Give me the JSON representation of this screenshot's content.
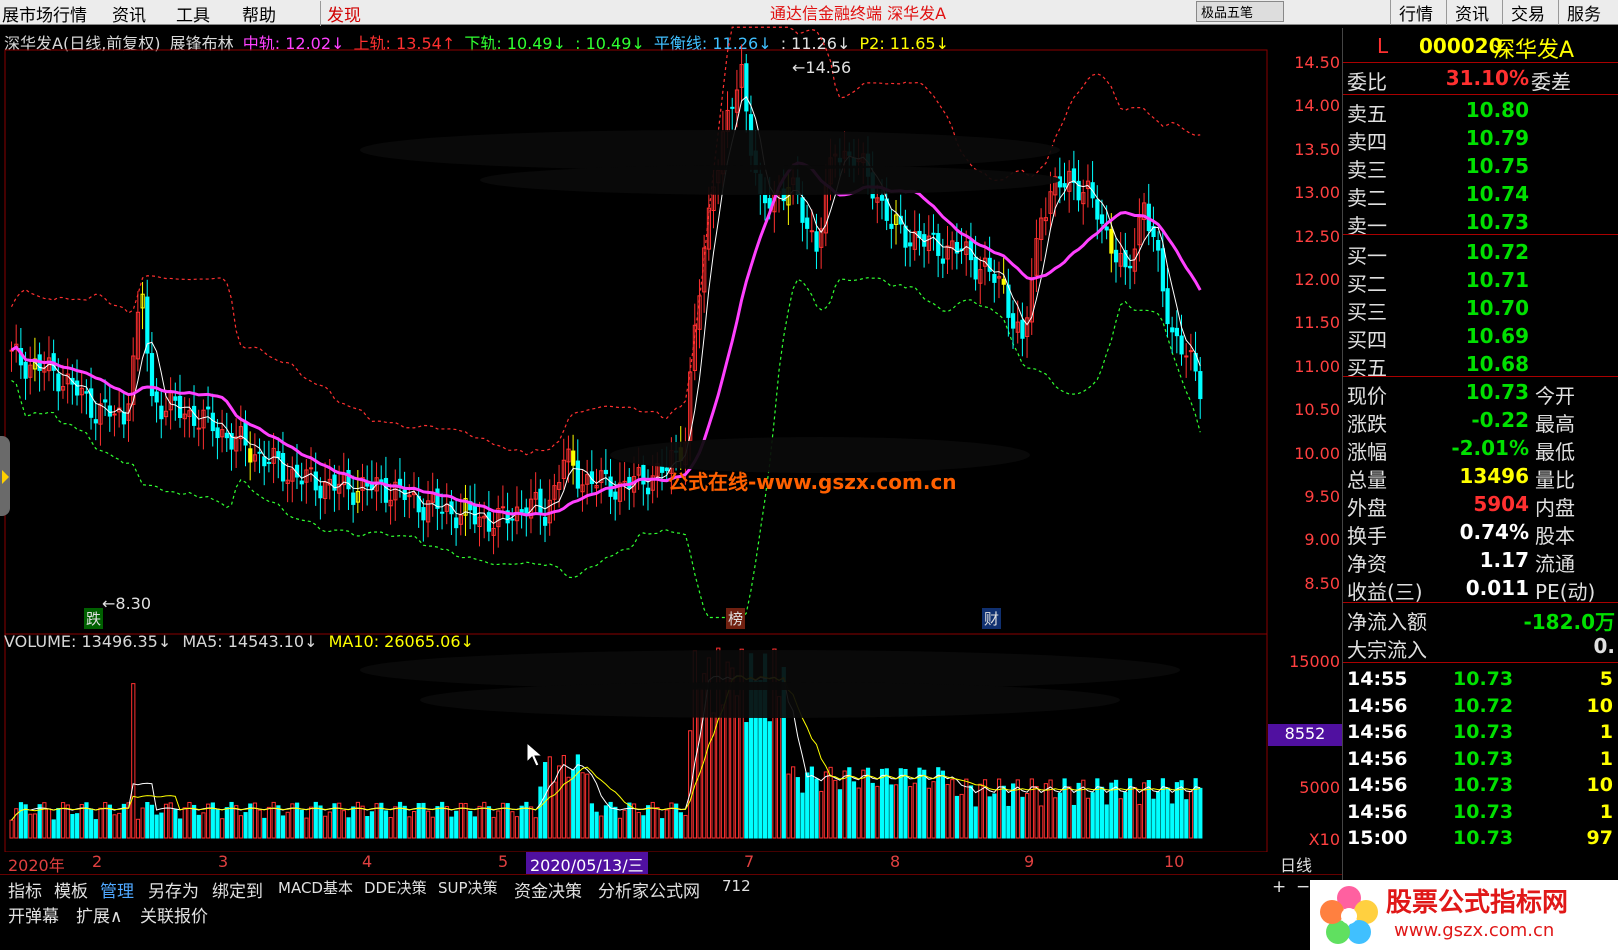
{
  "menu": {
    "items": [
      "展市场行情",
      "资讯",
      "工具",
      "帮助"
    ],
    "faxian": "发现",
    "center_text": "通达信金融终端  深华发A",
    "right_widget": "极品五笔",
    "right_buttons": [
      "行情",
      "资讯",
      "交易",
      "服务"
    ]
  },
  "chart_title": {
    "name": "深华发A(日线,前复权)",
    "indicator": "展锋布林",
    "mid": "中轨: 12.02↓",
    "upper": "上轨: 13.54↑",
    "lower": "下轨: 10.49↓",
    "blank": ": 10.49↓",
    "balance": "平衡线: 11.26↓",
    "blank2": ": 11.26↓",
    "p2": "P2: 11.65↓",
    "colors": {
      "mid": "#ff40ff",
      "upper": "#ff3030",
      "lower": "#30ff30",
      "blank": "#30ff30",
      "balance": "#40c0ff",
      "blank2": "#e0e0e0",
      "p2": "#ffff00"
    }
  },
  "volume_title": {
    "volume": "VOLUME: 13496.35↓",
    "ma5": "MA5: 14543.10↓",
    "ma10": "MA10: 26065.06↓"
  },
  "price_axis": [
    "14.50",
    "14.00",
    "13.50",
    "13.00",
    "12.50",
    "12.00",
    "11.50",
    "11.00",
    "10.50",
    "10.00",
    "9.50",
    "9.00",
    "8.50"
  ],
  "volume_axis": [
    "15000",
    "5000",
    "X10"
  ],
  "volume_highlight": "8552",
  "annotations": {
    "high": "14.56",
    "low": "8.30",
    "die": "跌",
    "bang": "榜",
    "cai": "财"
  },
  "date_axis": [
    "2020年",
    "2",
    "3",
    "4",
    "5",
    "2020/05/13/三",
    "7",
    "8",
    "9",
    "10"
  ],
  "period": "日线",
  "watermark": "公式在线-www.gszx.com.cn",
  "quote": {
    "flag": "L",
    "code": "000020",
    "name": "深华发A",
    "weibi_label": "委比",
    "weibi": "31.10%",
    "weicha_label": "委差",
    "asks": [
      {
        "label": "卖五",
        "price": "10.80"
      },
      {
        "label": "卖四",
        "price": "10.79"
      },
      {
        "label": "卖三",
        "price": "10.75"
      },
      {
        "label": "卖二",
        "price": "10.74"
      },
      {
        "label": "卖一",
        "price": "10.73"
      }
    ],
    "bids": [
      {
        "label": "买一",
        "price": "10.72"
      },
      {
        "label": "买二",
        "price": "10.71"
      },
      {
        "label": "买三",
        "price": "10.70"
      },
      {
        "label": "买四",
        "price": "10.69"
      },
      {
        "label": "买五",
        "price": "10.68"
      }
    ],
    "stats": [
      {
        "label": "现价",
        "value": "10.73",
        "label2": "今开",
        "color": "#00e000"
      },
      {
        "label": "涨跌",
        "value": "-0.22",
        "label2": "最高",
        "color": "#00e000"
      },
      {
        "label": "涨幅",
        "value": "-2.01%",
        "label2": "最低",
        "color": "#00e000"
      },
      {
        "label": "总量",
        "value": "13496",
        "label2": "量比",
        "color": "#ffff00"
      },
      {
        "label": "外盘",
        "value": "5904",
        "label2": "内盘",
        "color": "#ff3030"
      },
      {
        "label": "换手",
        "value": "0.74%",
        "label2": "股本",
        "color": "#ffffff"
      },
      {
        "label": "净资",
        "value": "1.17",
        "label2": "流通",
        "color": "#ffffff"
      },
      {
        "label": "收益(三)",
        "value": "0.011",
        "label2": "PE(动)",
        "color": "#ffffff"
      }
    ],
    "flow": [
      {
        "label": "净流入额",
        "value": "-182.0万"
      },
      {
        "label": "大宗流入",
        "value": "0."
      }
    ],
    "ticks": [
      {
        "time": "14:55",
        "price": "10.73",
        "vol": "5"
      },
      {
        "time": "14:56",
        "price": "10.72",
        "vol": "10"
      },
      {
        "time": "14:56",
        "price": "10.73",
        "vol": "1"
      },
      {
        "time": "14:56",
        "price": "10.73",
        "vol": "1"
      },
      {
        "time": "14:56",
        "price": "10.73",
        "vol": "10"
      },
      {
        "time": "14:56",
        "price": "10.73",
        "vol": "1"
      },
      {
        "time": "15:00",
        "price": "10.73",
        "vol": "97"
      }
    ]
  },
  "tabs": [
    "指标",
    "模板",
    "管理",
    "另存为",
    "绑定到",
    "MACD基本",
    "DDE决策",
    "SUP决策",
    "资金决策",
    "分析家公式网",
    "712"
  ],
  "tabs_active": "管理",
  "tabs2": [
    "开弹幕",
    "扩展∧",
    "关联报价"
  ],
  "logo": {
    "line1": "股票公式指标网",
    "line2": "www.gszx.com.cn"
  },
  "colors": {
    "up": "#ff3030",
    "down": "#00ffff",
    "mid": "#ff40ff",
    "bands": "#ff3030",
    "lower": "#30ff30",
    "ma": "#ffffff",
    "yellow": "#ffff00"
  }
}
